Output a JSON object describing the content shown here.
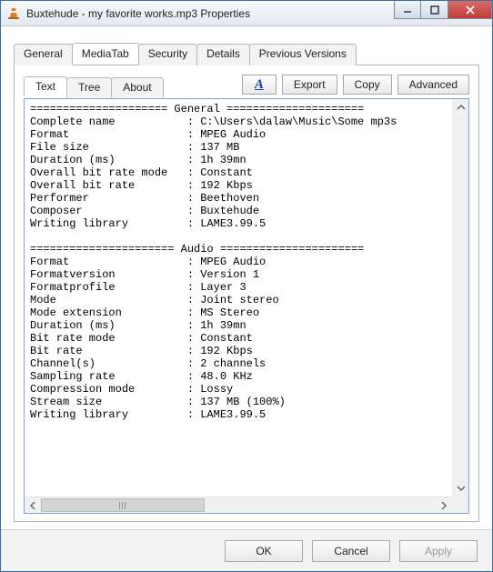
{
  "window": {
    "title": "Buxtehude - my favorite works.mp3 Properties"
  },
  "tabs": {
    "general": "General",
    "mediatab": "MediaTab",
    "security": "Security",
    "details": "Details",
    "previous": "Previous Versions"
  },
  "subtabs": {
    "text": "Text",
    "tree": "Tree",
    "about": "About"
  },
  "toolbar": {
    "export": "Export",
    "copy": "Copy",
    "advanced": "Advanced"
  },
  "footer": {
    "ok": "OK",
    "cancel": "Cancel",
    "apply": "Apply"
  },
  "info": {
    "general_header": "===================== General =====================",
    "general": {
      "complete_name": {
        "k": "Complete name",
        "v": "C:\\Users\\dalaw\\Music\\Some mp3s"
      },
      "format": {
        "k": "Format",
        "v": "MPEG Audio"
      },
      "file_size": {
        "k": "File size",
        "v": "137 MB"
      },
      "duration": {
        "k": "Duration (ms)",
        "v": "1h 39mn"
      },
      "obr_mode": {
        "k": "Overall bit rate mode",
        "v": "Constant"
      },
      "obr": {
        "k": "Overall bit rate",
        "v": "192 Kbps"
      },
      "performer": {
        "k": "Performer",
        "v": "Beethoven"
      },
      "composer": {
        "k": "Composer",
        "v": "Buxtehude"
      },
      "writing_lib": {
        "k": "Writing library",
        "v": "LAME3.99.5"
      }
    },
    "audio_header": "====================== Audio ======================",
    "audio": {
      "format": {
        "k": "Format",
        "v": "MPEG Audio"
      },
      "format_version": {
        "k": "Formatversion",
        "v": "Version 1"
      },
      "format_profile": {
        "k": "Formatprofile",
        "v": "Layer 3"
      },
      "mode": {
        "k": "Mode",
        "v": "Joint stereo"
      },
      "mode_ext": {
        "k": "Mode extension",
        "v": "MS Stereo"
      },
      "duration": {
        "k": "Duration (ms)",
        "v": "1h 39mn"
      },
      "br_mode": {
        "k": "Bit rate mode",
        "v": "Constant"
      },
      "br": {
        "k": "Bit rate",
        "v": "192 Kbps"
      },
      "channels": {
        "k": "Channel(s)",
        "v": "2 channels"
      },
      "sampling": {
        "k": "Sampling rate",
        "v": "48.0 KHz"
      },
      "compression": {
        "k": "Compression mode",
        "v": "Lossy"
      },
      "stream_size": {
        "k": "Stream size",
        "v": "137 MB (100%)"
      },
      "writing_lib": {
        "k": "Writing library",
        "v": "LAME3.99.5"
      }
    }
  }
}
